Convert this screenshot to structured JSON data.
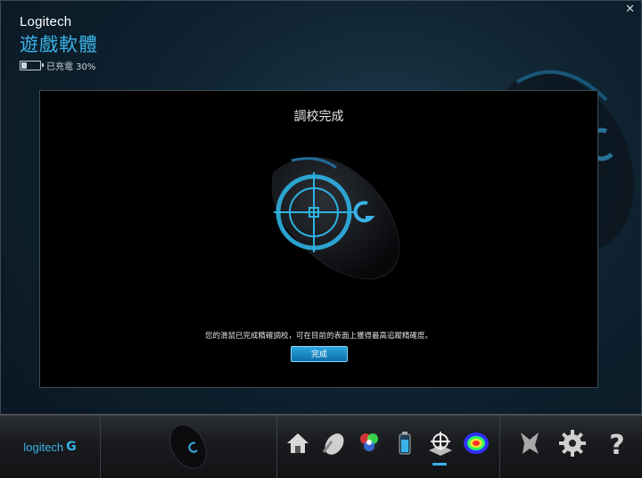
{
  "window": {
    "close_label": "✕"
  },
  "header": {
    "brand": "Logitech",
    "app_title": "遊戲軟體",
    "battery_text": "已充電 30%",
    "battery_percent": 30
  },
  "panel": {
    "title": "調校完成",
    "message": "您的滑鼠已完成精確調校，可在目前的表面上獲得最高追蹤精確度。",
    "done_button": "完成"
  },
  "bottom_bar": {
    "logo_text": "logitech",
    "icons": [
      "home-icon",
      "pointer-settings-icon",
      "lighting-icon",
      "battery-icon",
      "surface-tuning-icon",
      "heatmap-icon",
      "arx-control-icon",
      "settings-gear-icon",
      "help-icon"
    ],
    "active_icon": "surface-tuning-icon"
  },
  "colors": {
    "accent": "#3ab3e8",
    "panel_bg": "#000000",
    "button": "#1a8ccc"
  }
}
